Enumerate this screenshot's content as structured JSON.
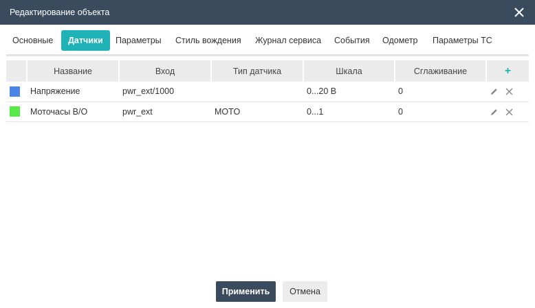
{
  "window": {
    "title": "Редактирование объекта"
  },
  "tabs": [
    {
      "label": "Основные"
    },
    {
      "label": "Датчики",
      "active": true
    },
    {
      "label": "Параметры"
    },
    {
      "label": "Стиль вождения"
    },
    {
      "label": "Журнал сервиса"
    },
    {
      "label": "События"
    },
    {
      "label": "Одометр"
    },
    {
      "label": "Параметры ТС"
    }
  ],
  "table": {
    "columns": [
      "Название",
      "Вход",
      "Тип датчика",
      "Шкала",
      "Сглаживание"
    ],
    "add_label": "+",
    "rows": [
      {
        "color": "#4a86e8",
        "name": "Напряжение",
        "input": "pwr_ext/1000",
        "type": "",
        "scale": "0...20 В",
        "smoothing": "0"
      },
      {
        "color": "#57e84a",
        "name": "Моточасы В/О",
        "input": "pwr_ext",
        "type": "MOTO",
        "scale": "0...1",
        "smoothing": "0"
      }
    ]
  },
  "footer": {
    "apply_label": "Применить",
    "cancel_label": "Отмена"
  },
  "colors": {
    "header": "#3b4b5e",
    "accent": "#1fb3b8"
  }
}
